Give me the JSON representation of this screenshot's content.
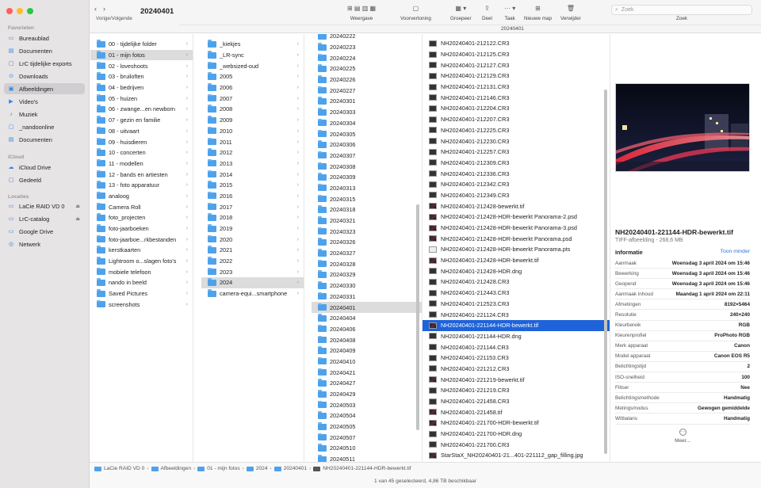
{
  "window": {
    "title": "20240401",
    "path_title": "20240401",
    "nav_label": "Vorige/Volgende"
  },
  "toolbar": {
    "buttons": [
      {
        "label": "Weergave",
        "icon": "view-icon"
      },
      {
        "label": "Voorvertoning",
        "icon": "preview-icon"
      },
      {
        "label": "Groepeer",
        "icon": "group-icon"
      },
      {
        "label": "Deel",
        "icon": "share-icon"
      },
      {
        "label": "Taak",
        "icon": "action-icon"
      },
      {
        "label": "Nieuwe map",
        "icon": "new-folder-icon"
      },
      {
        "label": "Verwijder",
        "icon": "trash-icon"
      }
    ],
    "search_placeholder": "Zoek",
    "search_label": "Zoek"
  },
  "sidebar": {
    "favorites_label": "Favorieten",
    "favorites": [
      "Bureaublad",
      "Documenten",
      "LrC tijdelijke exports",
      "Downloads",
      "Afbeeldingen",
      "Video's",
      "Muziek",
      "_nandoonline",
      "Documenten"
    ],
    "icloud_label": "iCloud",
    "icloud": [
      "iCloud Drive",
      "Gedeeld"
    ],
    "locations_label": "Locaties",
    "locations": [
      "LaCie RAID VD 0",
      "LrC-catalog",
      "Google Drive",
      "Netwerk"
    ]
  },
  "columns": {
    "col1": [
      "00 - tijdelijke folder",
      "01 - mijn fotos",
      "02 - loveshoots",
      "03 - bruiloften",
      "04 - bedrijven",
      "05 - huizen",
      "06 - zwange...en newborn",
      "07 - gezin en familie",
      "08 - uitvaart",
      "09 - huisdieren",
      "10 - concerten",
      "11 - modellen",
      "12 - bands en artiesten",
      "13 - foto apparatuur",
      "analoog",
      "Camera Roll",
      "foto_projecten",
      "foto-jaarboeken",
      "foto-jaarboe...rkbestanden",
      "kerstkaarten",
      "Lightroom o...slagen foto's",
      "mobiele telefoon",
      "nando in beeld",
      "Saved Pictures",
      "screenshots"
    ],
    "col2": [
      "_kiekjes",
      "_LR-sync",
      "_websized-oud",
      "2005",
      "2006",
      "2007",
      "2008",
      "2009",
      "2010",
      "2011",
      "2012",
      "2013",
      "2014",
      "2015",
      "2016",
      "2017",
      "2018",
      "2019",
      "2020",
      "2021",
      "2022",
      "2023",
      "2024",
      "camera-equi...smartphone"
    ],
    "col3": [
      "20240222",
      "20240223",
      "20240224",
      "20240225",
      "20240226",
      "20240227",
      "20240301",
      "20240303",
      "20240304",
      "20240305",
      "20240306",
      "20240307",
      "20240308",
      "20240309",
      "20240313",
      "20240315",
      "20240318",
      "20240321",
      "20240323",
      "20240326",
      "20240327",
      "20240328",
      "20240329",
      "20240330",
      "20240331",
      "20240401",
      "20240404",
      "20240406",
      "20240408",
      "20240409",
      "20240410",
      "20240421",
      "20240427",
      "20240429",
      "20240503",
      "20240504",
      "20240505",
      "20240507",
      "20240510",
      "20240511"
    ],
    "col4": [
      "NH20240401-212122.CR3",
      "NH20240401-212125.CR3",
      "NH20240401-212127.CR3",
      "NH20240401-212129.CR3",
      "NH20240401-212131.CR3",
      "NH20240401-212146.CR3",
      "NH20240401-212204.CR3",
      "NH20240401-212207.CR3",
      "NH20240401-212225.CR3",
      "NH20240401-212230.CR3",
      "NH20240401-212257.CR3",
      "NH20240401-212309.CR3",
      "NH20240401-212336.CR3",
      "NH20240401-212342.CR3",
      "NH20240401-212349.CR3",
      "NH20240401-212428-bewerkt.tif",
      "NH20240401-212428-HDR-bewerkt Panorama-2.psd",
      "NH20240401-212428-HDR-bewerkt Panorama-3.psd",
      "NH20240401-212428-HDR-bewerkt Panorama.psd",
      "NH20240401-212428-HDR-bewerkt Panorama.pts",
      "NH20240401-212428-HDR-bewerkt.tif",
      "NH20240401-212428-HDR.dng",
      "NH20240401-212428.CR3",
      "NH20240401-212443.CR3",
      "NH20240401-212523.CR3",
      "NH20240401-221124.CR3",
      "NH20240401-221144-HDR-bewerkt.tif",
      "NH20240401-221144-HDR.dng",
      "NH20240401-221144.CR3",
      "NH20240401-221153.CR3",
      "NH20240401-221212.CR3",
      "NH20240401-221219-bewerkt.tif",
      "NH20240401-221219.CR3",
      "NH20240401-221458.CR3",
      "NH20240401-221458.tif",
      "NH20240401-221700-HDR-bewerkt.tif",
      "NH20240401-221700-HDR.dng",
      "NH20240401-221700.CR3",
      "StarStaX_NH20240401-21...401-221112_gap_filling.jpg"
    ]
  },
  "preview": {
    "name": "NH20240401-221144-HDR-bewerkt.tif",
    "subtitle": "TIFF-afbeelding - 268,6 MB",
    "info_label": "Informatie",
    "toggle_label": "Toon minder",
    "info": [
      {
        "k": "Aanmaak",
        "v": "Woensdag 3 april 2024 om 15:46"
      },
      {
        "k": "Bewerking",
        "v": "Woensdag 3 april 2024 om 15:46"
      },
      {
        "k": "Geopend",
        "v": "Woensdag 3 april 2024 om 15:46"
      },
      {
        "k": "Aanmaak inhoud",
        "v": "Maandag 1 april 2024 om 22:11"
      },
      {
        "k": "Afmetingen",
        "v": "8192×5464"
      },
      {
        "k": "Resolutie",
        "v": "240×240"
      },
      {
        "k": "Kleurbereik",
        "v": "RGB"
      },
      {
        "k": "Kleurenprofiel",
        "v": "ProPhoto RGB"
      },
      {
        "k": "Merk apparaat",
        "v": "Canon"
      },
      {
        "k": "Model apparaat",
        "v": "Canon EOS R5"
      },
      {
        "k": "Belichtingstijd",
        "v": "2"
      },
      {
        "k": "ISO-snelheid",
        "v": "100"
      },
      {
        "k": "Flitser",
        "v": "Nee"
      },
      {
        "k": "Belichtingsmethode",
        "v": "Handmatig"
      },
      {
        "k": "Metingsmodus",
        "v": "Gewogen gemiddelde"
      },
      {
        "k": "Witbalans",
        "v": "Handmatig"
      }
    ],
    "more_label": "Meer..."
  },
  "breadcrumb": [
    "LaCie RAID VD 0",
    "Afbeeldingen",
    "01 - mijn fotos",
    "2024",
    "20240401",
    "NH20240401-221144-HDR-bewerkt.tif"
  ],
  "status": "1 van 45 geselecteerd, 4,86 TB beschikbaar"
}
